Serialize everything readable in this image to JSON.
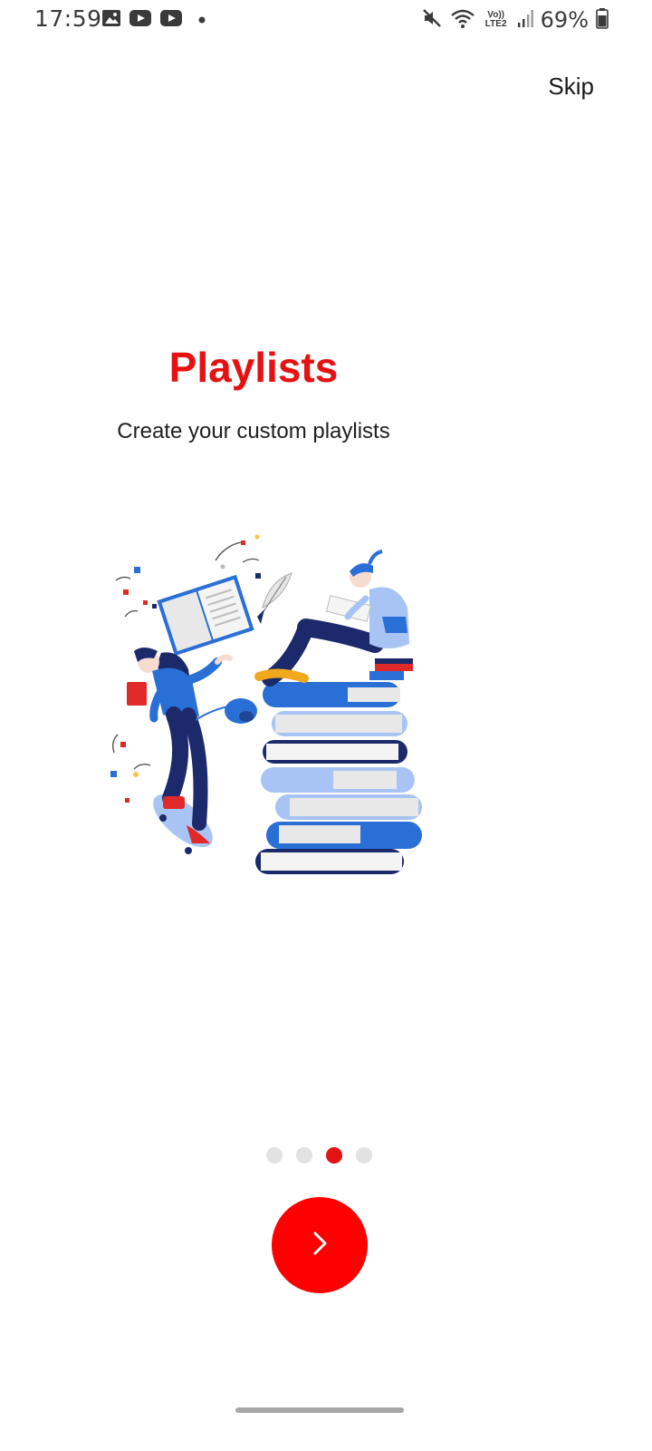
{
  "status_bar": {
    "time": "17:59",
    "battery": "69%",
    "network": "Vo)) LTE2",
    "left_icons": [
      "gallery-icon",
      "youtube-icon",
      "youtube-icon",
      "dot-icon"
    ],
    "right_icons": [
      "mute-icon",
      "wifi-icon",
      "lte-icon",
      "signal-icon",
      "battery-icon"
    ]
  },
  "header": {
    "skip_label": "Skip"
  },
  "onboarding": {
    "title": "Playlists",
    "subtitle": "Create your custom playlists",
    "illustration": "reading-books-illustration",
    "page_index": 3,
    "page_count": 4
  },
  "colors": {
    "accent": "#e41212",
    "next_button": "#ff0000",
    "dot_inactive": "#e2e2e2"
  },
  "icons": {
    "next": "chevron-right-icon"
  }
}
